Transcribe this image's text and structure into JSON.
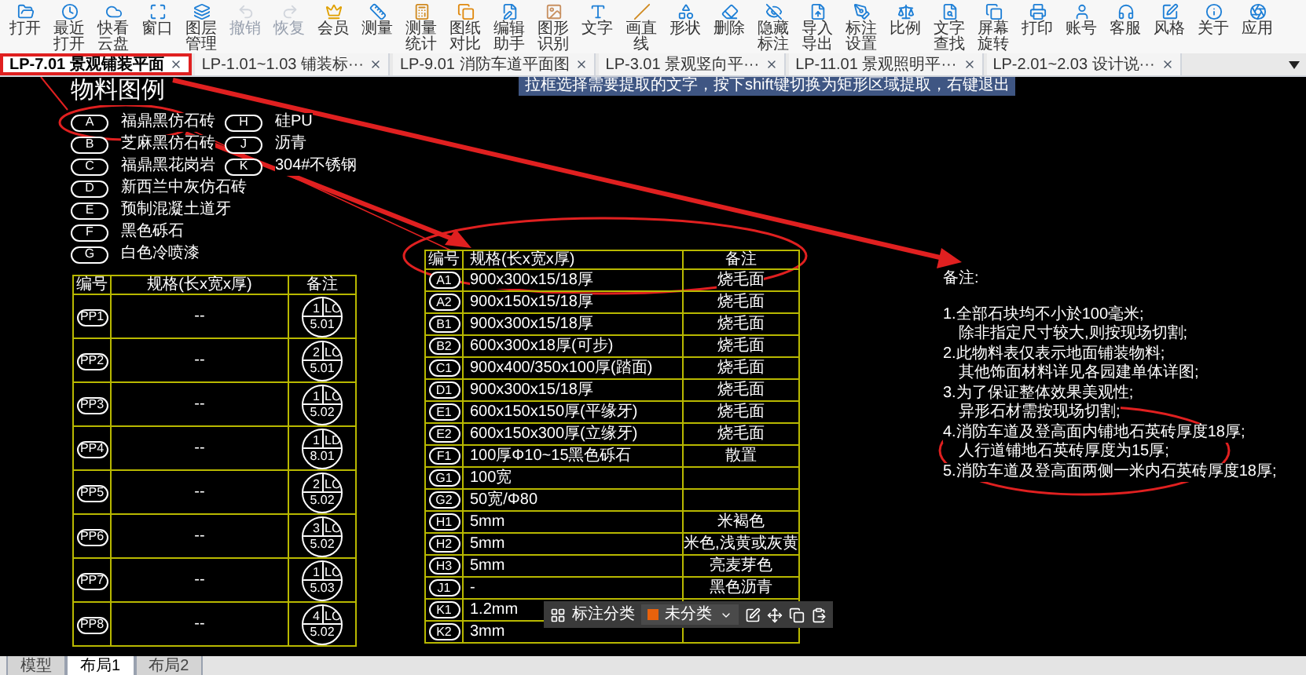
{
  "toolbar": [
    {
      "label": "打开",
      "disabled": false
    },
    {
      "label": "最近打开",
      "disabled": false
    },
    {
      "label": "快看云盘",
      "disabled": false
    },
    {
      "label": "窗口",
      "disabled": false
    },
    {
      "label": "图层管理",
      "disabled": false
    },
    {
      "label": "撤销",
      "disabled": true
    },
    {
      "label": "恢复",
      "disabled": true
    },
    {
      "label": "会员",
      "disabled": false
    },
    {
      "label": "测量",
      "disabled": false
    },
    {
      "label": "测量统计",
      "disabled": false
    },
    {
      "label": "图纸对比",
      "disabled": false
    },
    {
      "label": "编辑助手",
      "disabled": false
    },
    {
      "label": "图形识别",
      "disabled": false
    },
    {
      "label": "文字",
      "disabled": false
    },
    {
      "label": "画直线",
      "disabled": false
    },
    {
      "label": "形状",
      "disabled": false
    },
    {
      "label": "删除",
      "disabled": false
    },
    {
      "label": "隐藏标注",
      "disabled": false
    },
    {
      "label": "导入导出",
      "disabled": false
    },
    {
      "label": "标注设置",
      "disabled": false
    },
    {
      "label": "比例",
      "disabled": false
    },
    {
      "label": "文字查找",
      "disabled": false
    },
    {
      "label": "屏幕旋转",
      "disabled": false
    },
    {
      "label": "打印",
      "disabled": false
    },
    {
      "label": "账号",
      "disabled": false
    },
    {
      "label": "客服",
      "disabled": false
    },
    {
      "label": "风格",
      "disabled": false
    },
    {
      "label": "关于",
      "disabled": false
    },
    {
      "label": "应用",
      "disabled": false
    }
  ],
  "tabs": [
    {
      "label": "LP-7.01 景观铺装平面",
      "selected": true
    },
    {
      "label": "LP-1.01~1.03 铺装标···",
      "selected": false
    },
    {
      "label": "LP-9.01 消防车道平面图",
      "selected": false
    },
    {
      "label": "LP-3.01 景观竖向平···",
      "selected": false
    },
    {
      "label": "LP-11.01 景观照明平···",
      "selected": false
    },
    {
      "label": "LP-2.01~2.03 设计说···",
      "selected": false
    }
  ],
  "tooltip": "拉框选择需要提取的文字，按下shift键切换为矩形区域提取，右键退出",
  "legend": {
    "title": "物料图例",
    "columns": [
      [
        {
          "code": "A",
          "name": "福鼎黑仿石砖"
        },
        {
          "code": "B",
          "name": "芝麻黑仿石砖"
        },
        {
          "code": "C",
          "name": "福鼎黑花岗岩"
        },
        {
          "code": "D",
          "name": "新西兰中灰仿石砖"
        },
        {
          "code": "E",
          "name": "预制混凝土道牙"
        },
        {
          "code": "F",
          "name": "黑色砾石"
        },
        {
          "code": "G",
          "name": "白色冷喷漆"
        }
      ],
      [
        {
          "code": "H",
          "name": "硅PU"
        },
        {
          "code": "J",
          "name": "沥青"
        },
        {
          "code": "K",
          "name": "304#不锈钢"
        }
      ]
    ]
  },
  "detail_table": {
    "columns": [
      "编号",
      "规格(长x宽x厚)",
      "备注"
    ],
    "rows": [
      {
        "code": "PP1",
        "spec": "--",
        "index": {
          "number": "1",
          "drawing": "LC",
          "sheet": "5.01"
        }
      },
      {
        "code": "PP2",
        "spec": "--",
        "index": {
          "number": "2",
          "drawing": "LC",
          "sheet": "5.01"
        }
      },
      {
        "code": "PP3",
        "spec": "--",
        "index": {
          "number": "1",
          "drawing": "LC",
          "sheet": "5.02"
        }
      },
      {
        "code": "PP4",
        "spec": "--",
        "index": {
          "number": "1",
          "drawing": "LD",
          "sheet": "8.01"
        }
      },
      {
        "code": "PP5",
        "spec": "--",
        "index": {
          "number": "2",
          "drawing": "LC",
          "sheet": "5.02"
        }
      },
      {
        "code": "PP6",
        "spec": "--",
        "index": {
          "number": "3",
          "drawing": "LC",
          "sheet": "5.02"
        }
      },
      {
        "code": "PP7",
        "spec": "--",
        "index": {
          "number": "1",
          "drawing": "LC",
          "sheet": "5.03"
        }
      },
      {
        "code": "PP8",
        "spec": "--",
        "index": {
          "number": "4",
          "drawing": "LC",
          "sheet": "5.02"
        }
      }
    ]
  },
  "material_table": {
    "columns": [
      "编号",
      "规格(长x宽x厚)",
      "备注"
    ],
    "rows": [
      {
        "code": "A1",
        "spec": "900x300x15/18厚",
        "remark": "烧毛面"
      },
      {
        "code": "A2",
        "spec": "900x150x15/18厚",
        "remark": "烧毛面"
      },
      {
        "code": "B1",
        "spec": "900x300x15/18厚",
        "remark": "烧毛面"
      },
      {
        "code": "B2",
        "spec": "600x300x18厚(可步)",
        "remark": "烧毛面"
      },
      {
        "code": "C1",
        "spec": "900x400/350x100厚(踏面)",
        "remark": "烧毛面"
      },
      {
        "code": "D1",
        "spec": "900x300x15/18厚",
        "remark": "烧毛面"
      },
      {
        "code": "E1",
        "spec": "600x150x150厚(平缘牙)",
        "remark": "烧毛面"
      },
      {
        "code": "E2",
        "spec": "600x150x300厚(立缘牙)",
        "remark": "烧毛面"
      },
      {
        "code": "F1",
        "spec": "100厚Φ10~15黑色砾石",
        "remark": "散置"
      },
      {
        "code": "G1",
        "spec": "100宽"
      },
      {
        "code": "G2",
        "spec": "50宽/Φ80"
      },
      {
        "code": "H1",
        "spec": "5mm",
        "remark": "米褐色"
      },
      {
        "code": "H2",
        "spec": "5mm",
        "remark": "米色,浅黄或灰黄"
      },
      {
        "code": "H3",
        "spec": "5mm",
        "remark": "亮麦芽色"
      },
      {
        "code": "J1",
        "spec": "-",
        "remark": "黑色沥青"
      },
      {
        "code": "K1",
        "spec": "1.2mm"
      },
      {
        "code": "K2",
        "spec": "3mm"
      }
    ]
  },
  "notes": {
    "title": "备注:",
    "items": [
      {
        "lines": [
          "1.全部石块均不小於100毫米;",
          "除非指定尺寸较大,则按现场切割;"
        ]
      },
      {
        "lines": [
          "2.此物料表仅表示地面铺装物料;",
          "其他饰面材料详见各园建单体详图;"
        ]
      },
      {
        "lines": [
          "3.为了保证整体效果美观性;",
          "异形石材需按现场切割;"
        ]
      },
      {
        "lines": [
          "4.消防车道及登高面内铺地石英砖厚度18厚;",
          "人行道铺地石英砖厚度为15厚;"
        ]
      },
      {
        "lines": [
          "5.消防车道及登高面两侧一米内石英砖厚度18厚;"
        ]
      }
    ]
  },
  "annotation_toolbar": {
    "label": "标注分类",
    "category": "未分类"
  },
  "layout_tabs": [
    {
      "label": "模型",
      "selected": false
    },
    {
      "label": "布局1",
      "selected": true
    },
    {
      "label": "布局2",
      "selected": false
    }
  ]
}
